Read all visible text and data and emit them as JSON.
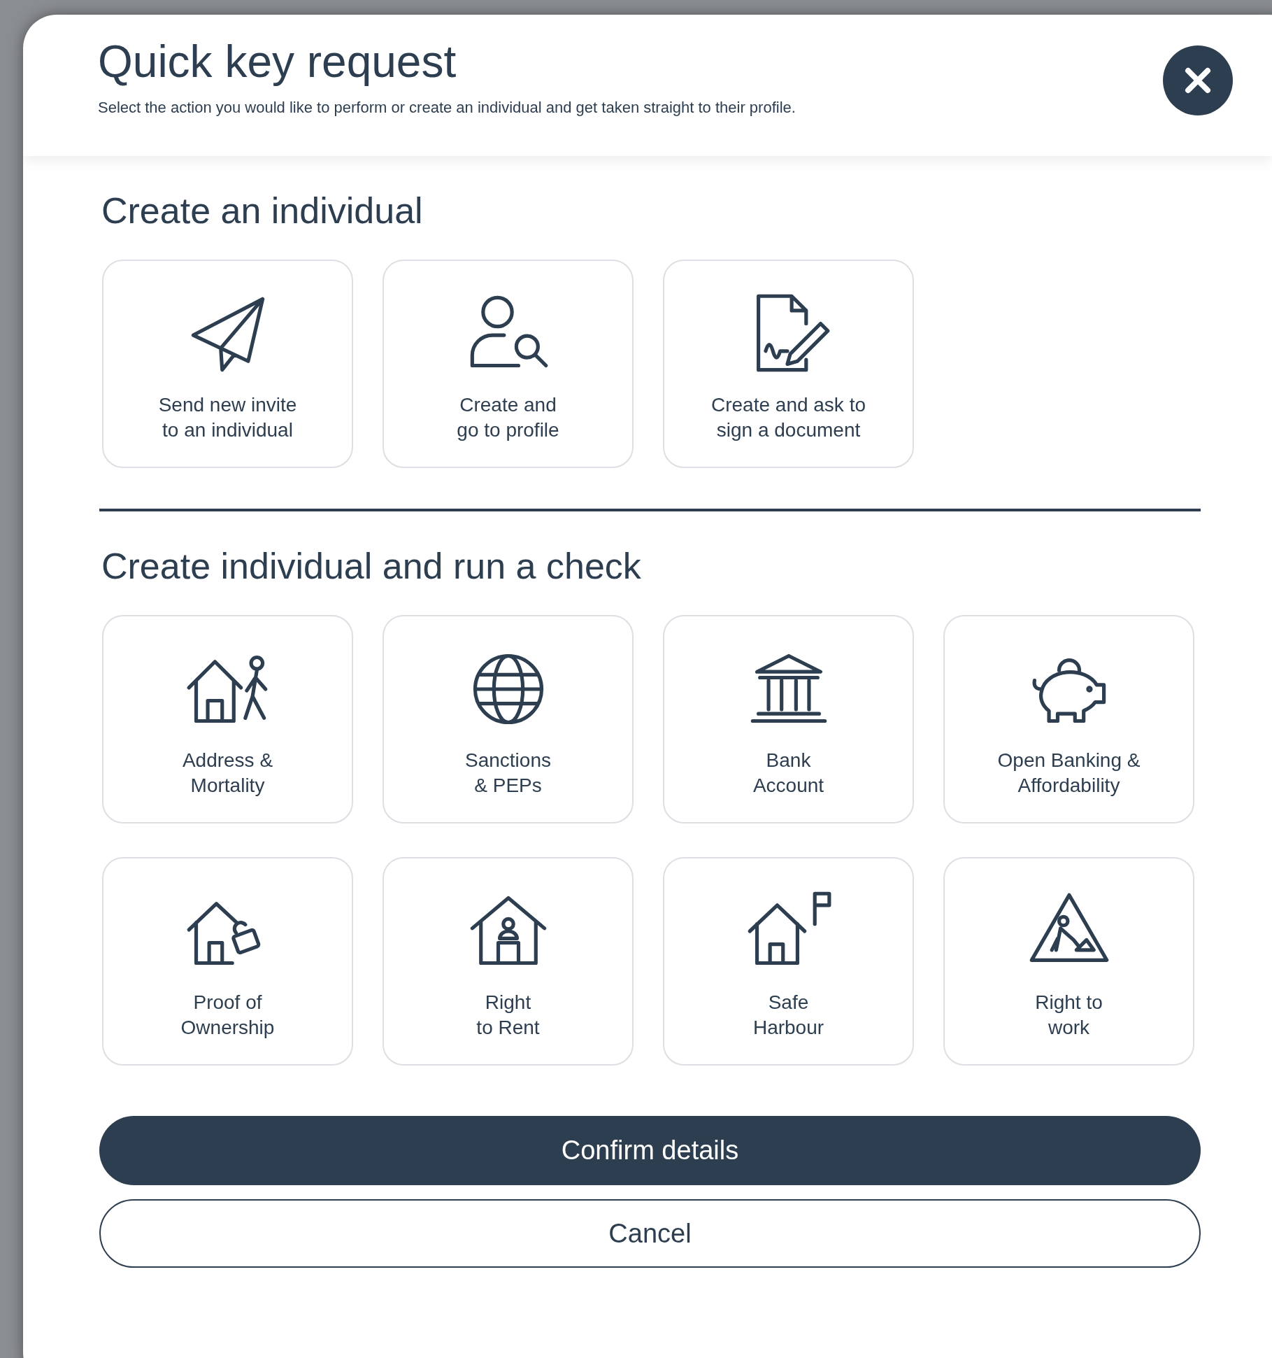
{
  "header": {
    "title": "Quick key request",
    "subtitle": "Select the action you would like to perform or create an individual and get taken straight to their profile."
  },
  "sections": [
    {
      "heading": "Create an individual",
      "options": [
        {
          "lines": [
            "Send new invite",
            "to an individual"
          ]
        },
        {
          "lines": [
            "Create and",
            "go to profile"
          ]
        },
        {
          "lines": [
            "Create and ask to",
            "sign a document"
          ]
        }
      ]
    },
    {
      "heading": "Create individual and run a check",
      "options": [
        {
          "lines": [
            "Address &",
            "Mortality"
          ]
        },
        {
          "lines": [
            "Sanctions",
            "& PEPs"
          ]
        },
        {
          "lines": [
            "Bank",
            "Account"
          ]
        },
        {
          "lines": [
            "Open Banking &",
            "Affordability"
          ]
        },
        {
          "lines": [
            "Proof of",
            "Ownership"
          ]
        },
        {
          "lines": [
            "Right",
            "to Rent"
          ]
        },
        {
          "lines": [
            "Safe",
            "Harbour"
          ]
        },
        {
          "lines": [
            "Right to",
            "work"
          ]
        }
      ]
    }
  ],
  "buttons": {
    "confirm": "Confirm details",
    "cancel": "Cancel"
  }
}
